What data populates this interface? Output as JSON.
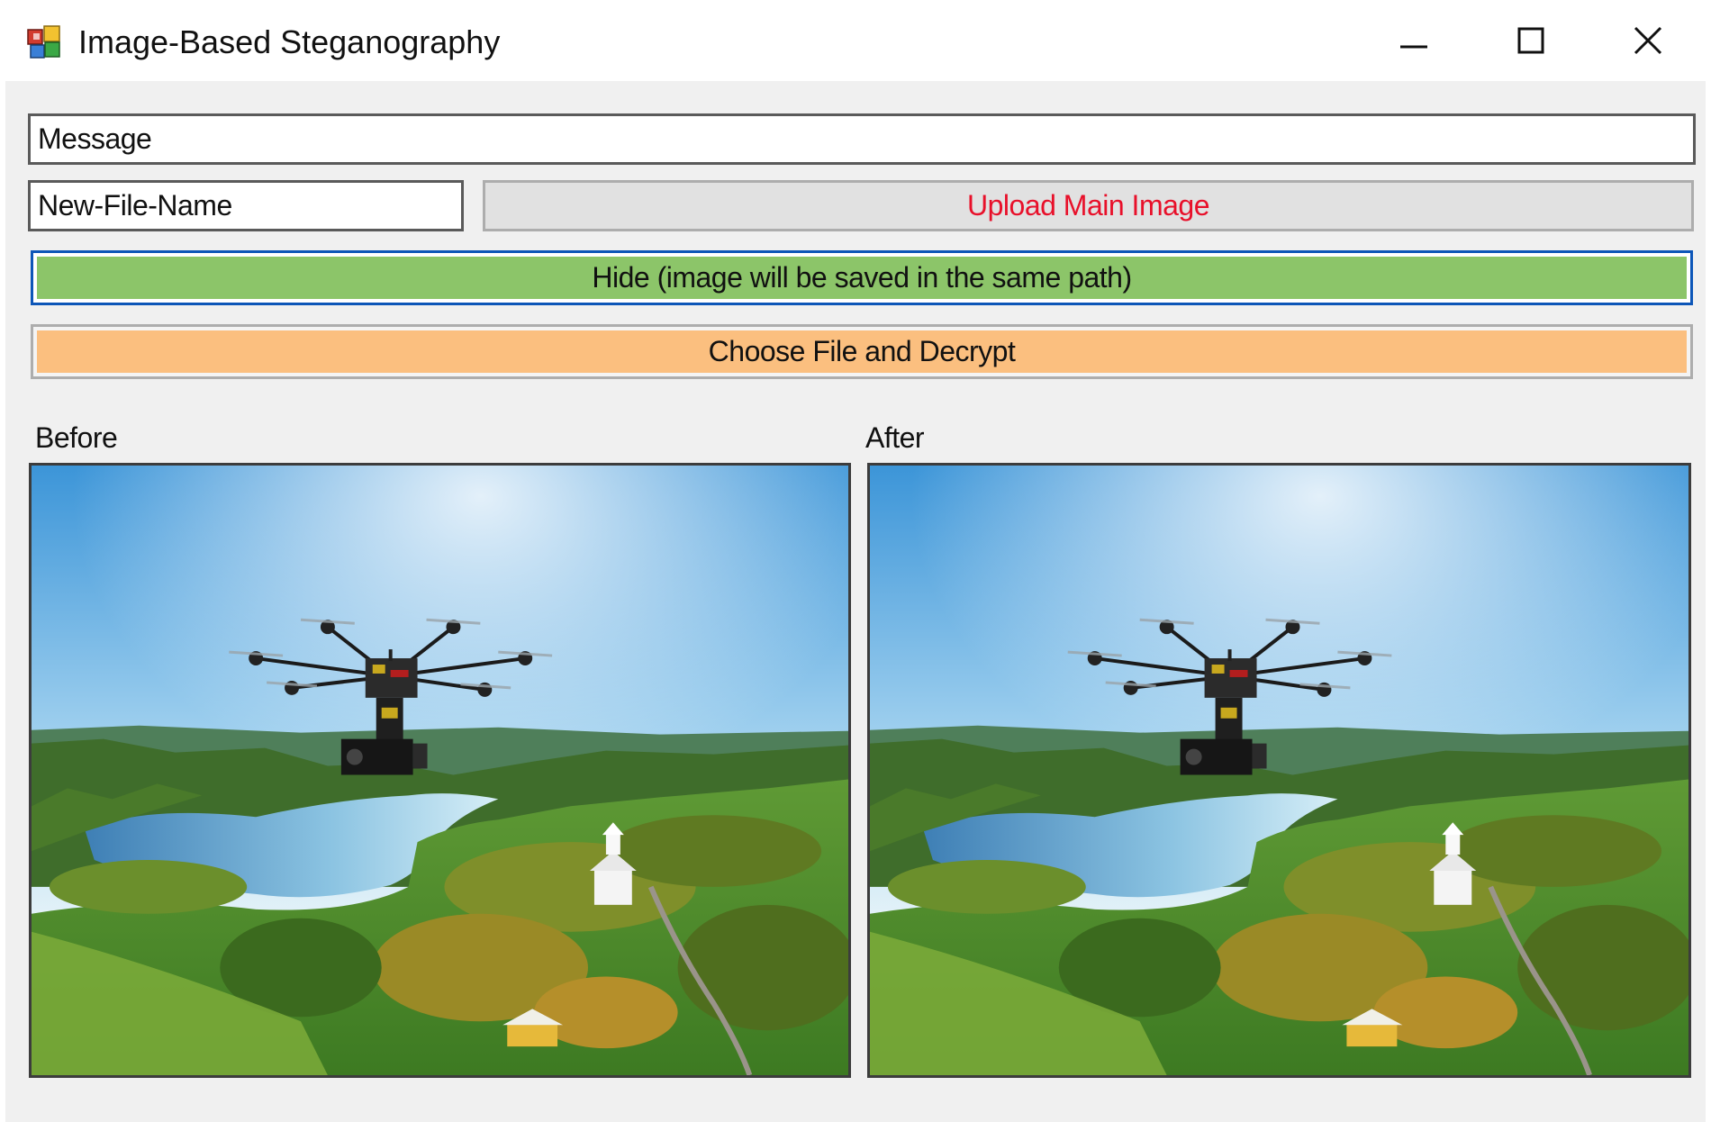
{
  "window": {
    "title": "Image-Based Steganography"
  },
  "form": {
    "message_value": "Message",
    "filename_value": "New-File-Name",
    "upload_label": "Upload Main Image",
    "hide_label": "Hide (image will be saved in the same path)",
    "decrypt_label": "Choose File and Decrypt",
    "before_label": "Before",
    "after_label": "After"
  },
  "colors": {
    "upload_text": "#e8102a",
    "hide_button": "#8cc569",
    "decrypt_button": "#fbbf7f",
    "focus_border": "#0d56b8"
  },
  "icons": {
    "app": "app-icon",
    "minimize": "minimize-icon",
    "maximize": "maximize-icon",
    "close": "close-icon"
  }
}
